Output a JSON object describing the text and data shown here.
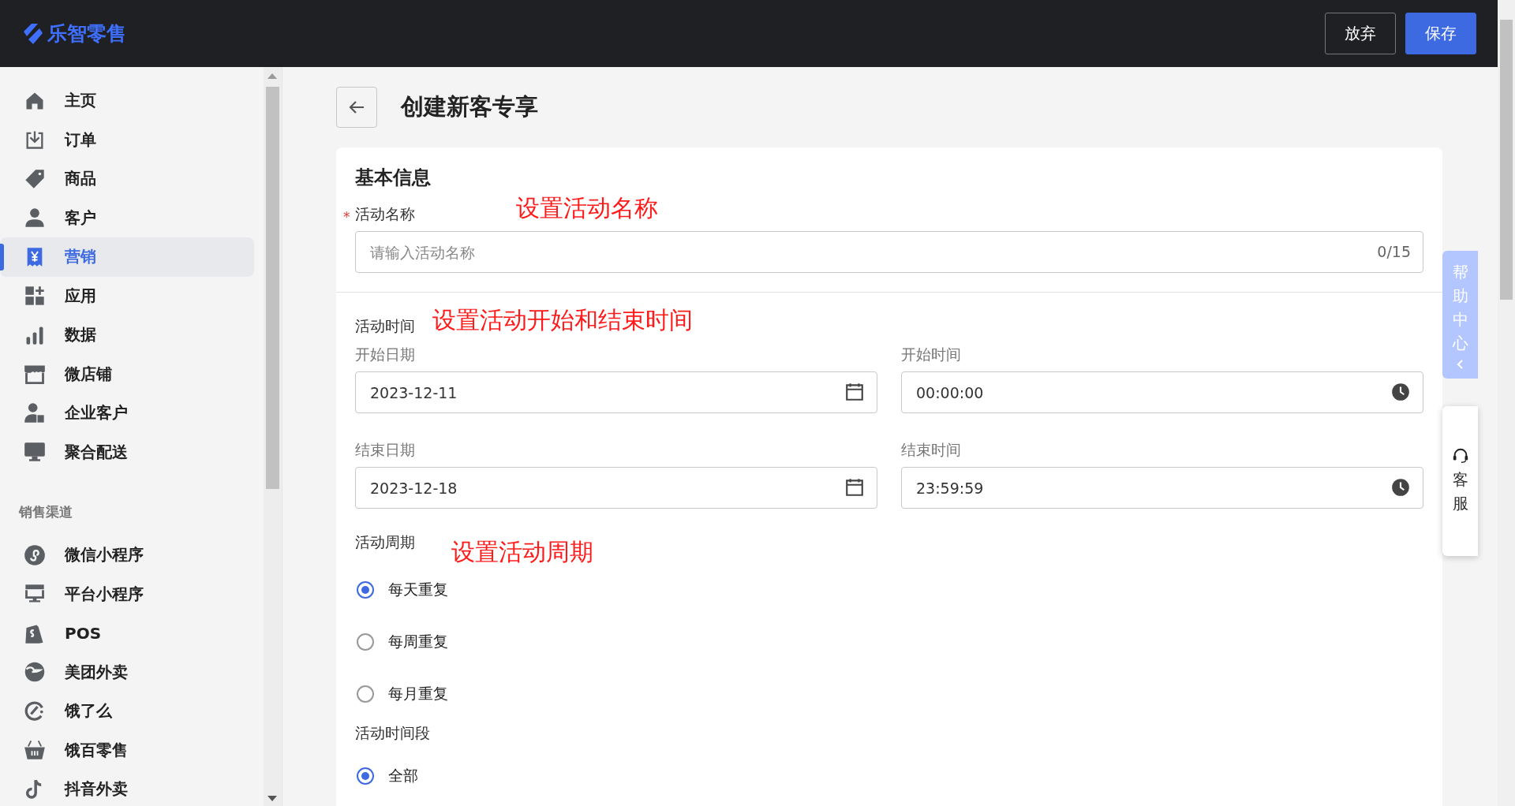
{
  "header": {
    "logo": "乐智零售",
    "buttons": [
      {
        "label": "放弃",
        "kind": "secondary"
      },
      {
        "label": "保存",
        "kind": "primary"
      }
    ]
  },
  "sidebar": {
    "items": [
      {
        "label": "主页",
        "selected": false
      },
      {
        "label": "订单",
        "selected": false
      },
      {
        "label": "商品",
        "selected": false
      },
      {
        "label": "客户",
        "selected": false
      },
      {
        "label": "营销",
        "selected": true
      },
      {
        "label": "应用",
        "selected": false
      },
      {
        "label": "数据",
        "selected": false
      },
      {
        "label": "微店铺",
        "selected": false
      },
      {
        "label": "企业客户",
        "selected": false
      },
      {
        "label": "聚合配送",
        "selected": false
      }
    ],
    "section_title": "销售渠道",
    "channels": [
      {
        "label": "微信小程序",
        "selected": false
      },
      {
        "label": "平台小程序",
        "selected": false
      },
      {
        "label": "POS",
        "selected": false
      },
      {
        "label": "美团外卖",
        "selected": false
      },
      {
        "label": "饿了么",
        "selected": false
      },
      {
        "label": "饿百零售",
        "selected": false
      },
      {
        "label": "抖音外卖",
        "selected": false
      }
    ]
  },
  "page": {
    "title": "创建新客专享"
  },
  "form": {
    "section_title": "基本信息",
    "name_field": {
      "required_mark": "*",
      "label": "活动名称",
      "placeholder": "请输入活动名称",
      "counter": "0/15",
      "annotation": "设置活动名称"
    },
    "time": {
      "title": "活动时间",
      "annotation": "设置活动开始和结束时间",
      "fields": [
        {
          "label": "开始日期",
          "value": "2023-12-11",
          "kind": "date"
        },
        {
          "label": "开始时间",
          "value": "00:00:00",
          "kind": "time"
        },
        {
          "label": "结束日期",
          "value": "2023-12-18",
          "kind": "date"
        },
        {
          "label": "结束时间",
          "value": "23:59:59",
          "kind": "time"
        }
      ]
    },
    "cycle": {
      "title": "活动周期",
      "annotation": "设置活动周期",
      "options": [
        {
          "label": "每天重复",
          "selected": true
        },
        {
          "label": "每周重复",
          "selected": false
        },
        {
          "label": "每月重复",
          "selected": false
        }
      ]
    },
    "period": {
      "title": "活动时间段",
      "options": [
        {
          "label": "全部",
          "selected": true
        }
      ]
    }
  },
  "help": {
    "label": "帮助中心",
    "service": "客服"
  }
}
